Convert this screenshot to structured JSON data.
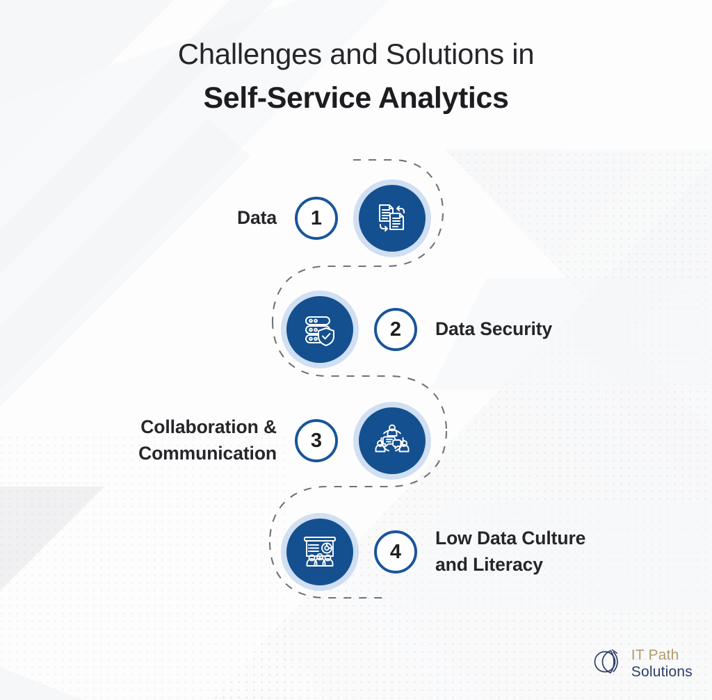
{
  "title": {
    "line1": "Challenges and Solutions in",
    "line2": "Self-Service Analytics"
  },
  "colors": {
    "brand_navy": "#14508f",
    "ring_navy": "#1a559c",
    "halo_blue": "#c3d6ee",
    "text_dark": "#26262a",
    "path_dash": "#6f7277",
    "logo_gold": "#b59b6e",
    "logo_navy": "#2d3f68",
    "background": "#fdfdfd"
  },
  "steps": [
    {
      "number": "1",
      "label": "Data",
      "icon": "document-sync-icon",
      "side": "label-left"
    },
    {
      "number": "2",
      "label": "Data Security",
      "icon": "server-shield-icon",
      "side": "label-right"
    },
    {
      "number": "3",
      "label": "Collaboration &\nCommunication",
      "icon": "team-collaboration-icon",
      "side": "label-left"
    },
    {
      "number": "4",
      "label": "Low Data Culture\nand Literacy",
      "icon": "presentation-audience-icon",
      "side": "label-right"
    }
  ],
  "logo": {
    "mark": "it-path-solutions-logo-mark",
    "top": "IT Path",
    "bottom": "Solutions"
  }
}
